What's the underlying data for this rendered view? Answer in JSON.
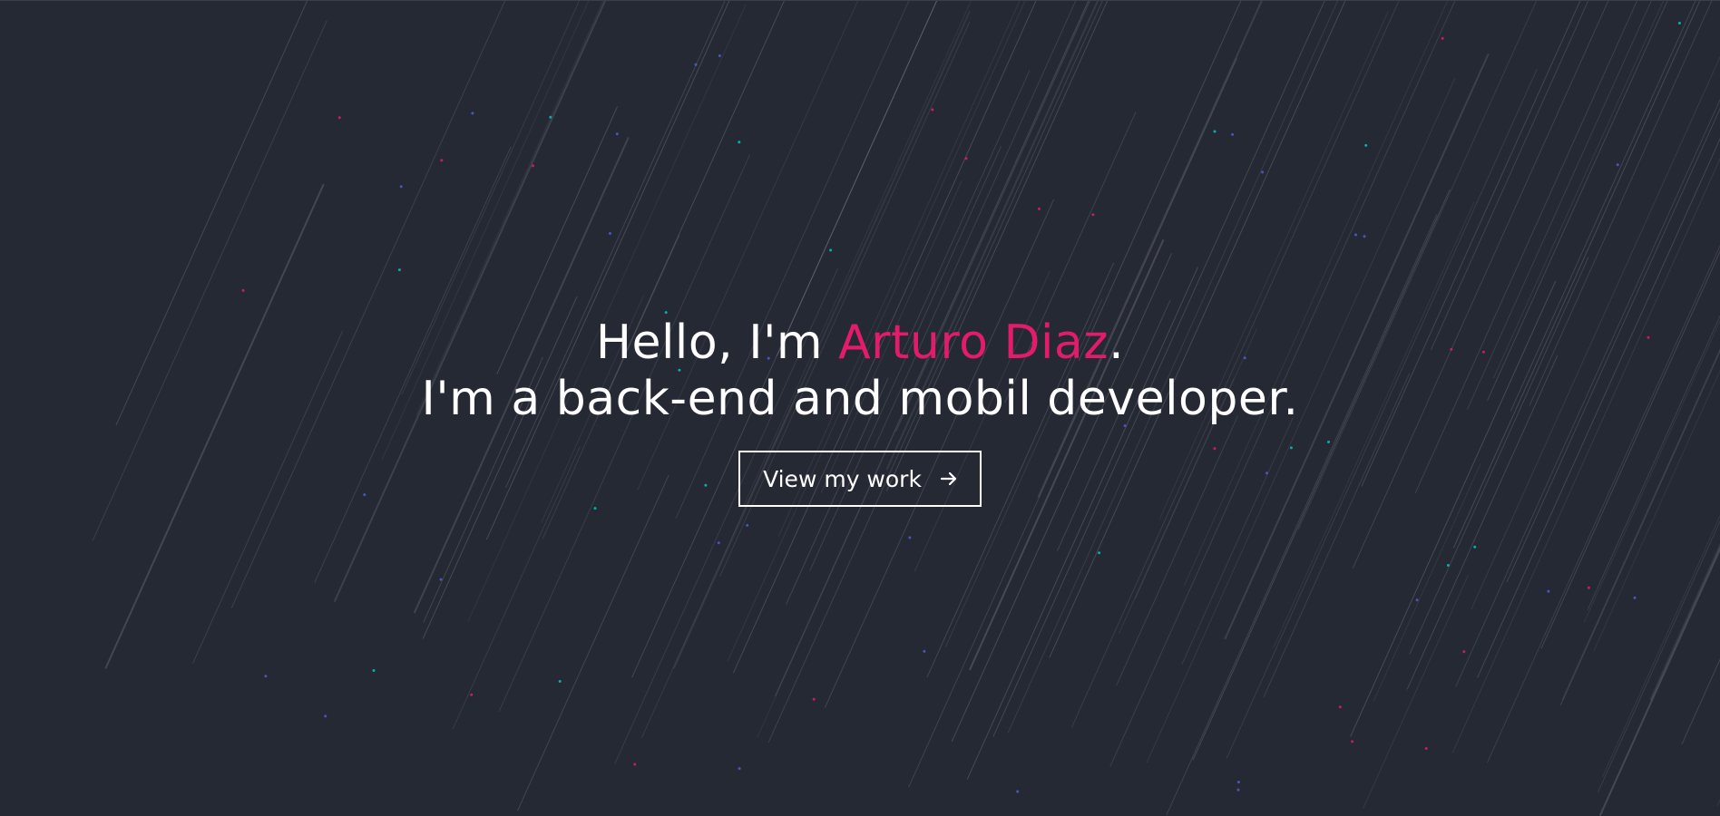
{
  "hero": {
    "greeting_prefix": "Hello, I'm ",
    "name": "Arturo Diaz",
    "greeting_suffix": ".",
    "subtitle": "I'm a back-end and mobil developer.",
    "cta_label": "View my work",
    "cta_icon": "arrow-right-icon"
  },
  "colors": {
    "background": "#252934",
    "accent": "#e31b6d",
    "text": "#ffffff",
    "particle_teal": "#04c2c9",
    "particle_pink": "#e31b6d",
    "particle_blue": "#4d5fd6"
  }
}
